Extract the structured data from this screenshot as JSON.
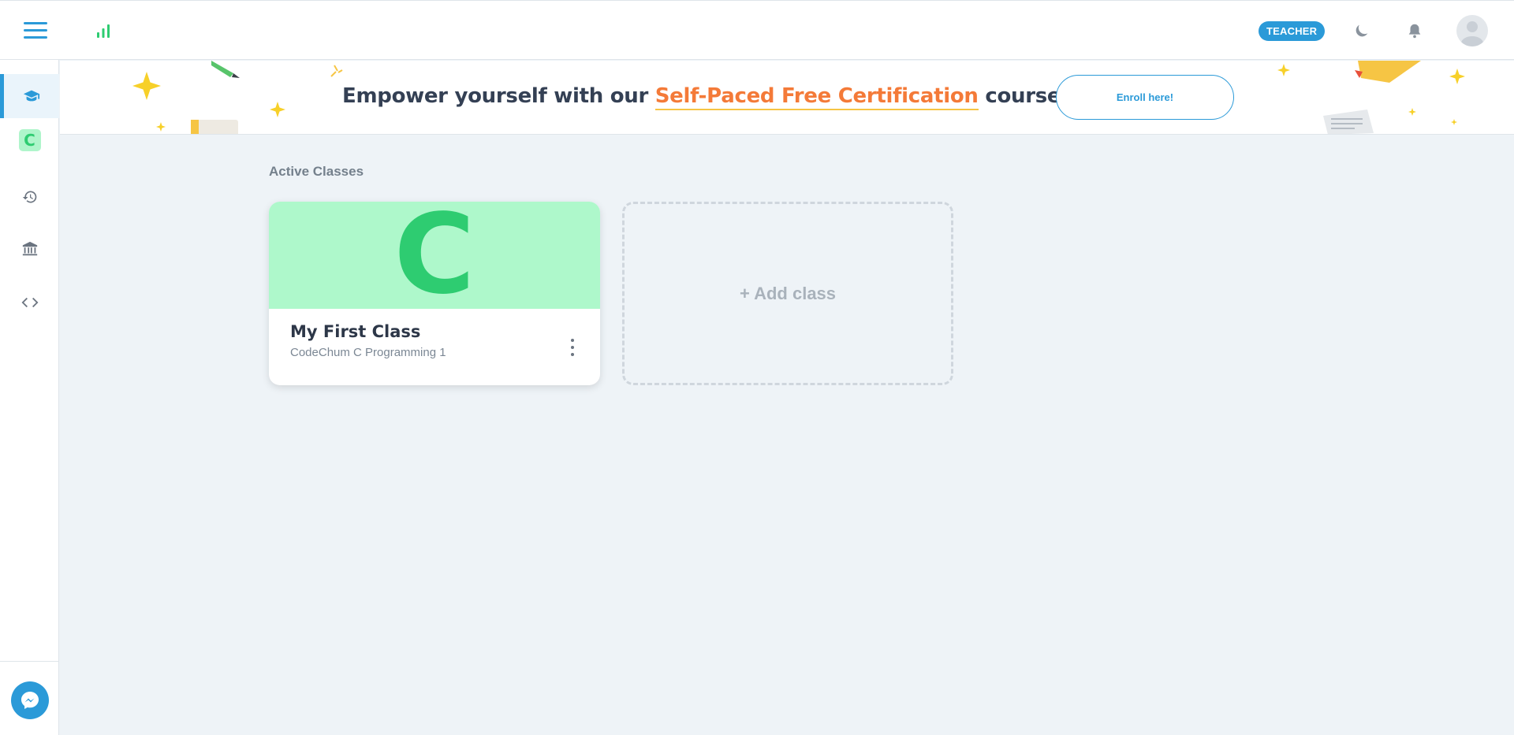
{
  "header": {
    "menu_icon": "hamburger-menu-icon",
    "stats_icon": "bar-chart-icon",
    "role_badge": "TEACHER",
    "theme_icon": "moon-icon",
    "notifications_icon": "bell-icon",
    "avatar_icon": "user-avatar-icon"
  },
  "sidebar": {
    "items": [
      {
        "icon": "graduation-cap-icon",
        "active": true
      },
      {
        "icon": "c-course-icon",
        "letter": "C"
      },
      {
        "icon": "history-icon"
      },
      {
        "icon": "institution-icon"
      },
      {
        "icon": "code-brackets-icon"
      }
    ],
    "chat_icon": "messenger-icon"
  },
  "banner": {
    "text_before": "Empower yourself with our ",
    "highlight": "Self-Paced Free Certification",
    "text_after": " courses!",
    "button_label": "Enroll here!"
  },
  "main": {
    "section_title": "Active Classes",
    "classes": [
      {
        "letter": "C",
        "name": "My First Class",
        "subtitle": "CodeChum C Programming 1"
      }
    ],
    "add_class_label": "+ Add class"
  },
  "colors": {
    "accent": "#2b9ad8",
    "course_green": "#2ecc71",
    "course_bg": "#aef8cb",
    "highlight": "#f47a38"
  }
}
